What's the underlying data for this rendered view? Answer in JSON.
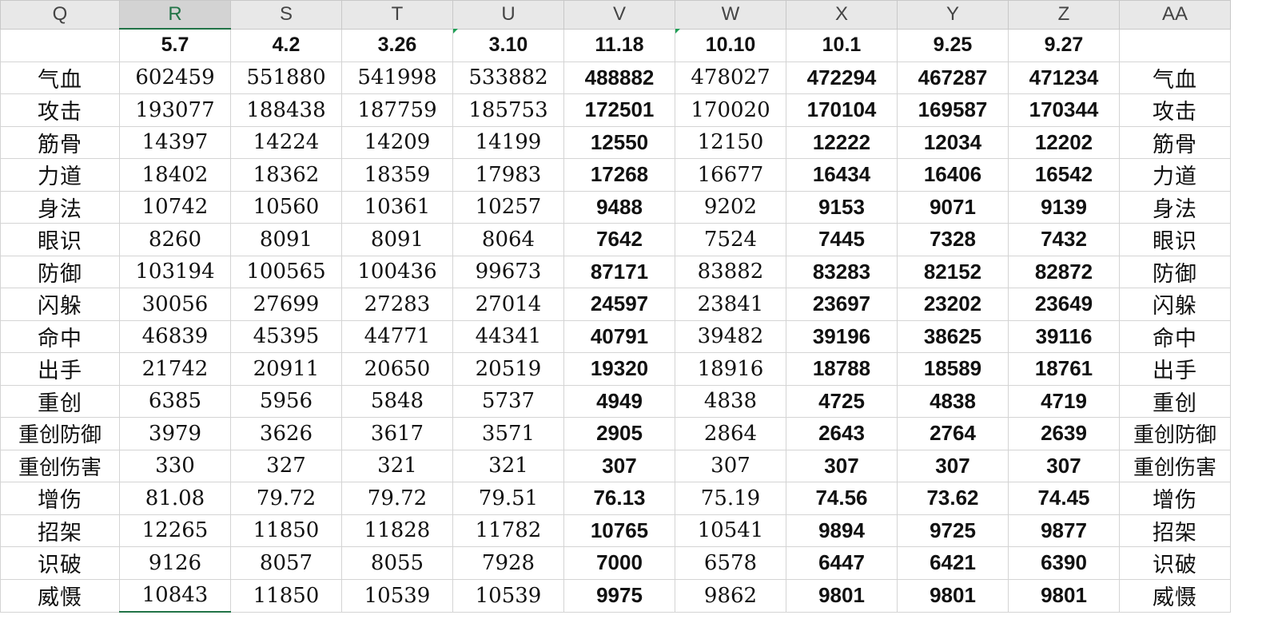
{
  "columns": [
    "Q",
    "R",
    "S",
    "T",
    "U",
    "V",
    "W",
    "X",
    "Y",
    "Z",
    "AA"
  ],
  "selected_column": "R",
  "accent_color": "#217346",
  "header_row": [
    "",
    "5.7",
    "4.2",
    "3.26",
    "3.10",
    "11.18",
    "10.10",
    "10.1",
    "9.25",
    "9.27",
    ""
  ],
  "rows": [
    {
      "label": "气血",
      "values": [
        "602459",
        "551880",
        "541998",
        "533882",
        "488882",
        "478027",
        "472294",
        "467287",
        "471234"
      ],
      "label_right": "气血"
    },
    {
      "label": "攻击",
      "values": [
        "193077",
        "188438",
        "187759",
        "185753",
        "172501",
        "170020",
        "170104",
        "169587",
        "170344"
      ],
      "label_right": "攻击"
    },
    {
      "label": "筋骨",
      "values": [
        "14397",
        "14224",
        "14209",
        "14199",
        "12550",
        "12150",
        "12222",
        "12034",
        "12202"
      ],
      "label_right": "筋骨"
    },
    {
      "label": "力道",
      "values": [
        "18402",
        "18362",
        "18359",
        "17983",
        "17268",
        "16677",
        "16434",
        "16406",
        "16542"
      ],
      "label_right": "力道"
    },
    {
      "label": "身法",
      "values": [
        "10742",
        "10560",
        "10361",
        "10257",
        "9488",
        "9202",
        "9153",
        "9071",
        "9139"
      ],
      "label_right": "身法"
    },
    {
      "label": "眼识",
      "values": [
        "8260",
        "8091",
        "8091",
        "8064",
        "7642",
        "7524",
        "7445",
        "7328",
        "7432"
      ],
      "label_right": "眼识"
    },
    {
      "label": "防御",
      "values": [
        "103194",
        "100565",
        "100436",
        "99673",
        "87171",
        "83882",
        "83283",
        "82152",
        "82872"
      ],
      "label_right": "防御"
    },
    {
      "label": "闪躲",
      "values": [
        "30056",
        "27699",
        "27283",
        "27014",
        "24597",
        "23841",
        "23697",
        "23202",
        "23649"
      ],
      "label_right": "闪躲"
    },
    {
      "label": "命中",
      "values": [
        "46839",
        "45395",
        "44771",
        "44341",
        "40791",
        "39482",
        "39196",
        "38625",
        "39116"
      ],
      "label_right": "命中"
    },
    {
      "label": "出手",
      "values": [
        "21742",
        "20911",
        "20650",
        "20519",
        "19320",
        "18916",
        "18788",
        "18589",
        "18761"
      ],
      "label_right": "出手"
    },
    {
      "label": "重创",
      "values": [
        "6385",
        "5956",
        "5848",
        "5737",
        "4949",
        "4838",
        "4725",
        "4838",
        "4719"
      ],
      "label_right": "重创"
    },
    {
      "label": "重创防御",
      "values": [
        "3979",
        "3626",
        "3617",
        "3571",
        "2905",
        "2864",
        "2643",
        "2764",
        "2639"
      ],
      "label_right": "重创防御"
    },
    {
      "label": "重创伤害",
      "values": [
        "330",
        "327",
        "321",
        "321",
        "307",
        "307",
        "307",
        "307",
        "307"
      ],
      "label_right": "重创伤害"
    },
    {
      "label": "增伤",
      "values": [
        "81.08",
        "79.72",
        "79.72",
        "79.51",
        "76.13",
        "75.19",
        "74.56",
        "73.62",
        "74.45"
      ],
      "label_right": "增伤"
    },
    {
      "label": "招架",
      "values": [
        "12265",
        "11850",
        "11828",
        "11782",
        "10765",
        "10541",
        "9894",
        "9725",
        "9877"
      ],
      "label_right": "招架"
    },
    {
      "label": "识破",
      "values": [
        "9126",
        "8057",
        "8055",
        "7928",
        "7000",
        "6578",
        "6447",
        "6421",
        "6390"
      ],
      "label_right": "识破"
    },
    {
      "label": "威慑",
      "values": [
        "10843",
        "11850",
        "10539",
        "10539",
        "9975",
        "9862",
        "9801",
        "9801",
        "9801"
      ],
      "label_right": "威慑"
    }
  ]
}
